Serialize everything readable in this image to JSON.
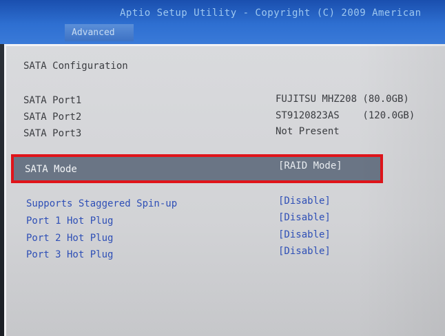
{
  "header": {
    "title": "Aptio Setup Utility - Copyright (C) 2009 American",
    "tab_label": "Advanced"
  },
  "section_title": "SATA Configuration",
  "ports": [
    {
      "label": "SATA Port1",
      "value": "FUJITSU MHZ208 (80.0GB)"
    },
    {
      "label": "SATA Port2",
      "value": "ST9120823AS    (120.0GB)"
    },
    {
      "label": "SATA Port3",
      "value": "Not Present"
    }
  ],
  "sata_mode": {
    "label": "SATA Mode",
    "value": "[RAID Mode]"
  },
  "options": [
    {
      "label": "Supports Staggered Spin-up",
      "value": "[Disable]"
    },
    {
      "label": "Port 1 Hot Plug",
      "value": "[Disable]"
    },
    {
      "label": "Port 2 Hot Plug",
      "value": "[Disable]"
    },
    {
      "label": "Port 3 Hot Plug",
      "value": "[Disable]"
    }
  ],
  "colors": {
    "header_blue": "#2e6fd1",
    "panel_gray": "#d2d3d6",
    "option_blue": "#2e4fb6",
    "highlight_red": "#e0141a",
    "selection_bg": "#6a7585"
  }
}
